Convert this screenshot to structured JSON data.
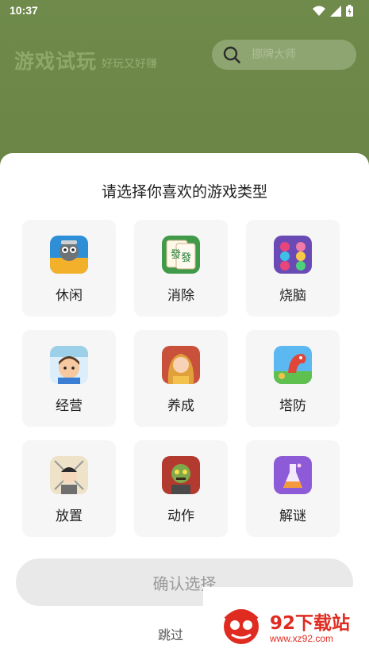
{
  "status_bar": {
    "time": "10:37"
  },
  "header": {
    "title": "游戏试玩",
    "subtitle": "好玩又好赚",
    "search_placeholder": "挪牌大师"
  },
  "sheet": {
    "title": "请选择你喜欢的游戏类型",
    "categories": [
      {
        "label": "休闲",
        "icon": "casual-game-icon"
      },
      {
        "label": "消除",
        "icon": "mahjong-tile-icon"
      },
      {
        "label": "烧脑",
        "icon": "color-balls-icon"
      },
      {
        "label": "经营",
        "icon": "rebirth-boy-icon"
      },
      {
        "label": "养成",
        "icon": "girl-portrait-icon"
      },
      {
        "label": "塔防",
        "icon": "dragon-icon"
      },
      {
        "label": "放置",
        "icon": "swordsman-icon"
      },
      {
        "label": "动作",
        "icon": "zombie-icon"
      },
      {
        "label": "解谜",
        "icon": "potion-icon"
      }
    ],
    "confirm_label": "确认选择",
    "skip_label": "跳过"
  },
  "watermark": {
    "brand": "92下载站",
    "url": "www.xz92.com"
  },
  "colors": {
    "header_bg": "#6b8448",
    "card_bg": "#f6f6f6",
    "button_bg": "#e9e9e9",
    "watermark_red": "#e02b20"
  }
}
